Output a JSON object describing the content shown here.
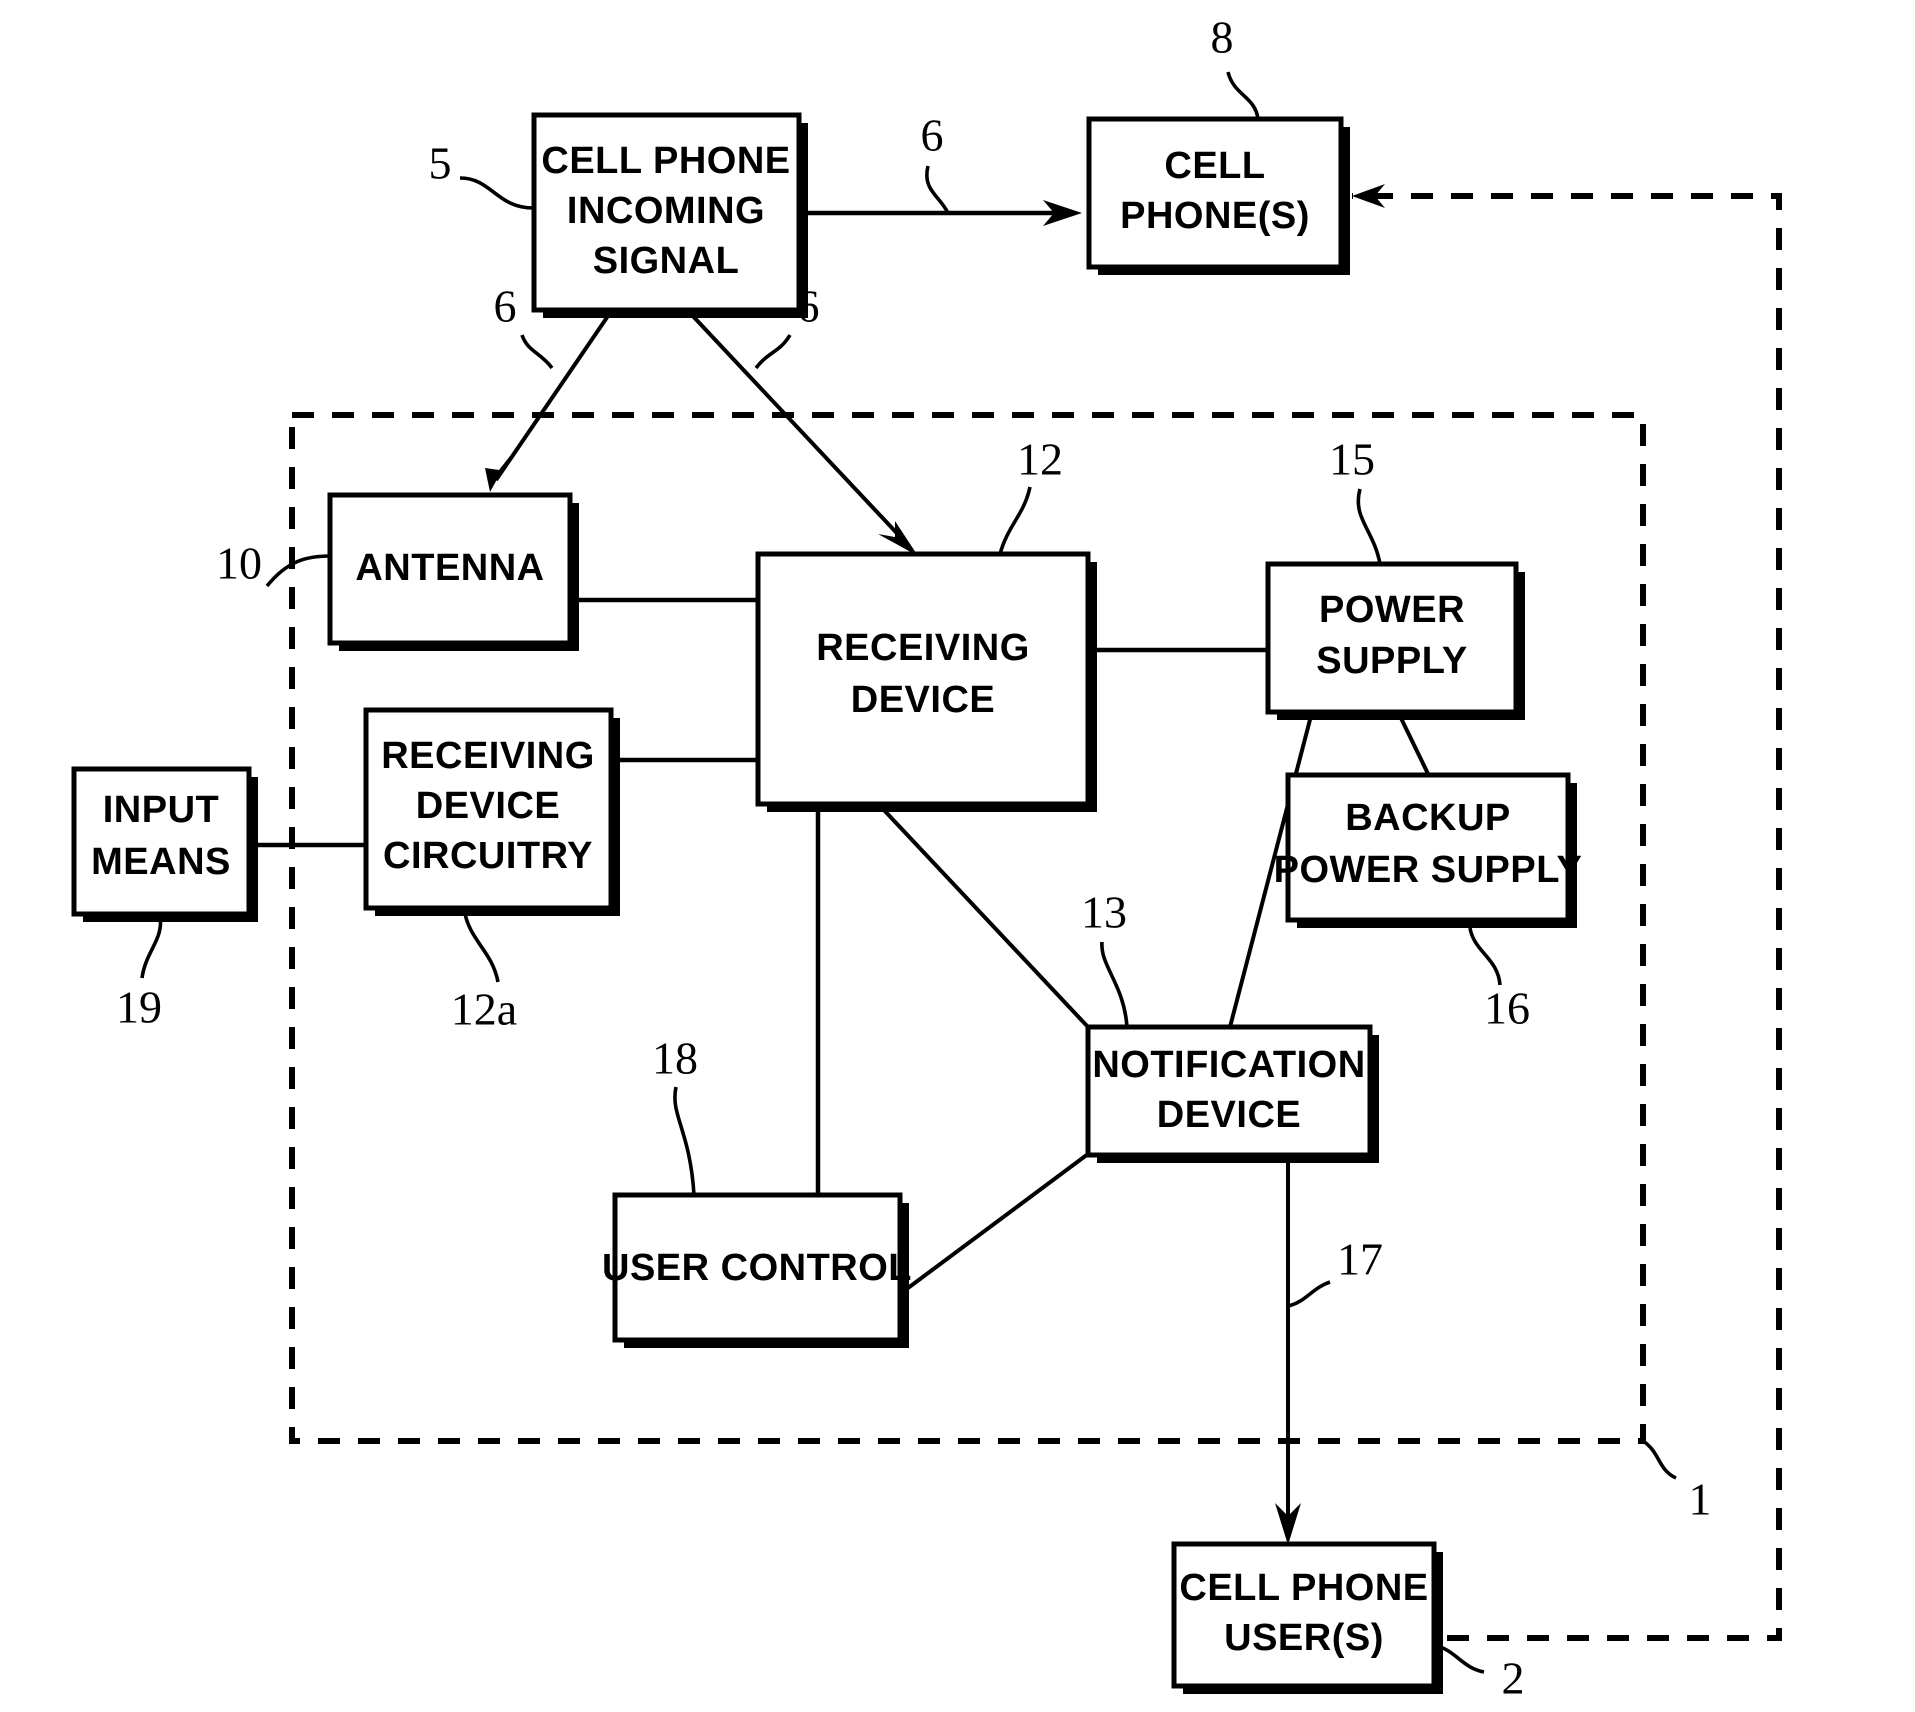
{
  "figure": {
    "kind": "patent-block-diagram",
    "background_color": "#ffffff",
    "line_color": "#000000"
  },
  "boxes": {
    "cell_phone_incoming_signal": {
      "label_lines": [
        "CELL PHONE",
        "INCOMING",
        "SIGNAL"
      ],
      "ref": "5"
    },
    "cell_phones": {
      "label_lines": [
        "CELL",
        "PHONE(S)"
      ],
      "ref": "8"
    },
    "antenna": {
      "label_lines": [
        "ANTENNA"
      ],
      "ref": "10"
    },
    "receiving_device": {
      "label_lines": [
        "RECEIVING",
        "DEVICE"
      ],
      "ref": "12"
    },
    "power_supply": {
      "label_lines": [
        "POWER",
        "SUPPLY"
      ],
      "ref": "15"
    },
    "backup_power_supply": {
      "label_lines": [
        "BACKUP",
        "POWER SUPPLY"
      ],
      "ref": "16"
    },
    "input_means": {
      "label_lines": [
        "INPUT",
        "MEANS"
      ],
      "ref": "19"
    },
    "receiving_device_circuitry": {
      "label_lines": [
        "RECEIVING",
        "DEVICE",
        "CIRCUITRY"
      ],
      "ref": "12a"
    },
    "notification_device": {
      "label_lines": [
        "NOTIFICATION",
        "DEVICE"
      ],
      "ref": "13"
    },
    "user_control": {
      "label_lines": [
        "USER CONTROL"
      ],
      "ref": "18"
    },
    "cell_phone_users": {
      "label_lines": [
        "CELL PHONE",
        "USER(S)"
      ],
      "ref": "2"
    }
  },
  "box_text": {
    "cell_phone_incoming_signal_l1": "CELL PHONE",
    "cell_phone_incoming_signal_l2": "INCOMING",
    "cell_phone_incoming_signal_l3": "SIGNAL",
    "cell_phones_l1": "CELL",
    "cell_phones_l2": "PHONE(S)",
    "antenna_l1": "ANTENNA",
    "receiving_device_l1": "RECEIVING",
    "receiving_device_l2": "DEVICE",
    "power_supply_l1": "POWER",
    "power_supply_l2": "SUPPLY",
    "backup_power_supply_l1": "BACKUP",
    "backup_power_supply_l2": "POWER SUPPLY",
    "input_means_l1": "INPUT",
    "input_means_l2": "MEANS",
    "receiving_device_circuitry_l1": "RECEIVING",
    "receiving_device_circuitry_l2": "DEVICE",
    "receiving_device_circuitry_l3": "CIRCUITRY",
    "notification_device_l1": "NOTIFICATION",
    "notification_device_l2": "DEVICE",
    "user_control_l1": "USER CONTROL",
    "cell_phone_users_l1": "CELL PHONE",
    "cell_phone_users_l2": "USER(S)"
  },
  "reference_numerals": {
    "system_boundary": "1",
    "cell_phone_users": "2",
    "cell_phone_incoming_signal": "5",
    "signal_path_to_phones": "6",
    "signal_path_to_antenna": "6",
    "signal_path_to_receiver": "6",
    "cell_phones": "8",
    "antenna": "10",
    "receiving_device": "12",
    "receiving_device_circuitry": "12a",
    "notification_device": "13",
    "power_supply": "15",
    "backup_power_supply": "16",
    "notification_path": "17",
    "user_control": "18",
    "input_means": "19"
  },
  "connections": [
    {
      "from": "cell_phone_incoming_signal",
      "to": "cell_phones",
      "style": "solid-arrow",
      "ref": "6"
    },
    {
      "from": "cell_phone_incoming_signal",
      "to": "antenna",
      "style": "solid-arrow",
      "ref": "6"
    },
    {
      "from": "cell_phone_incoming_signal",
      "to": "receiving_device",
      "style": "solid-arrow",
      "ref": "6"
    },
    {
      "from": "antenna",
      "to": "receiving_device",
      "style": "solid-line"
    },
    {
      "from": "receiving_device_circuitry",
      "to": "receiving_device",
      "style": "solid-line"
    },
    {
      "from": "input_means",
      "to": "receiving_device_circuitry",
      "style": "solid-line"
    },
    {
      "from": "receiving_device",
      "to": "power_supply",
      "style": "solid-line"
    },
    {
      "from": "power_supply",
      "to": "backup_power_supply",
      "style": "solid-line"
    },
    {
      "from": "power_supply",
      "to": "notification_device",
      "style": "solid-line"
    },
    {
      "from": "receiving_device",
      "to": "notification_device",
      "style": "solid-line"
    },
    {
      "from": "receiving_device",
      "to": "user_control",
      "style": "solid-line"
    },
    {
      "from": "user_control",
      "to": "notification_device",
      "style": "solid-line"
    },
    {
      "from": "notification_device",
      "to": "cell_phone_users",
      "style": "solid-arrow",
      "ref": "17"
    },
    {
      "from": "cell_phone_users",
      "to": "cell_phones",
      "style": "dashed-arrow"
    }
  ]
}
